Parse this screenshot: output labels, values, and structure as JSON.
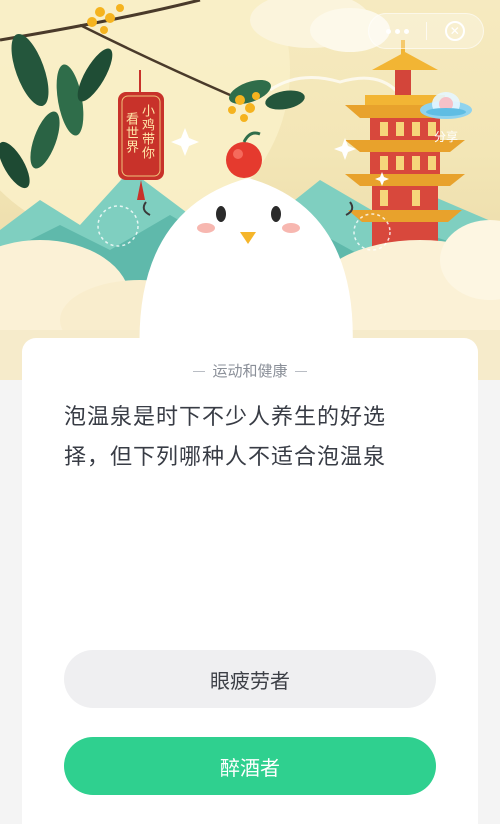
{
  "header": {
    "tag_line1": "小鸡带你",
    "tag_line2": "看世界",
    "share_label": "分享",
    "more_icon": "more-dots-icon",
    "close_icon": "close-circle-icon"
  },
  "quiz": {
    "category": "运动和健康",
    "question": "泡温泉是时下不少人养生的好选择，但下列哪种人不适合泡温泉",
    "options": [
      {
        "label": "眼疲劳者",
        "state": "default"
      },
      {
        "label": "醉酒者",
        "state": "selected"
      }
    ]
  },
  "colors": {
    "accent": "#2fd08f",
    "option_bg": "#efeff1",
    "question_text": "#383c45",
    "category_text": "#8a8f98",
    "tag_red": "#c8322a"
  }
}
